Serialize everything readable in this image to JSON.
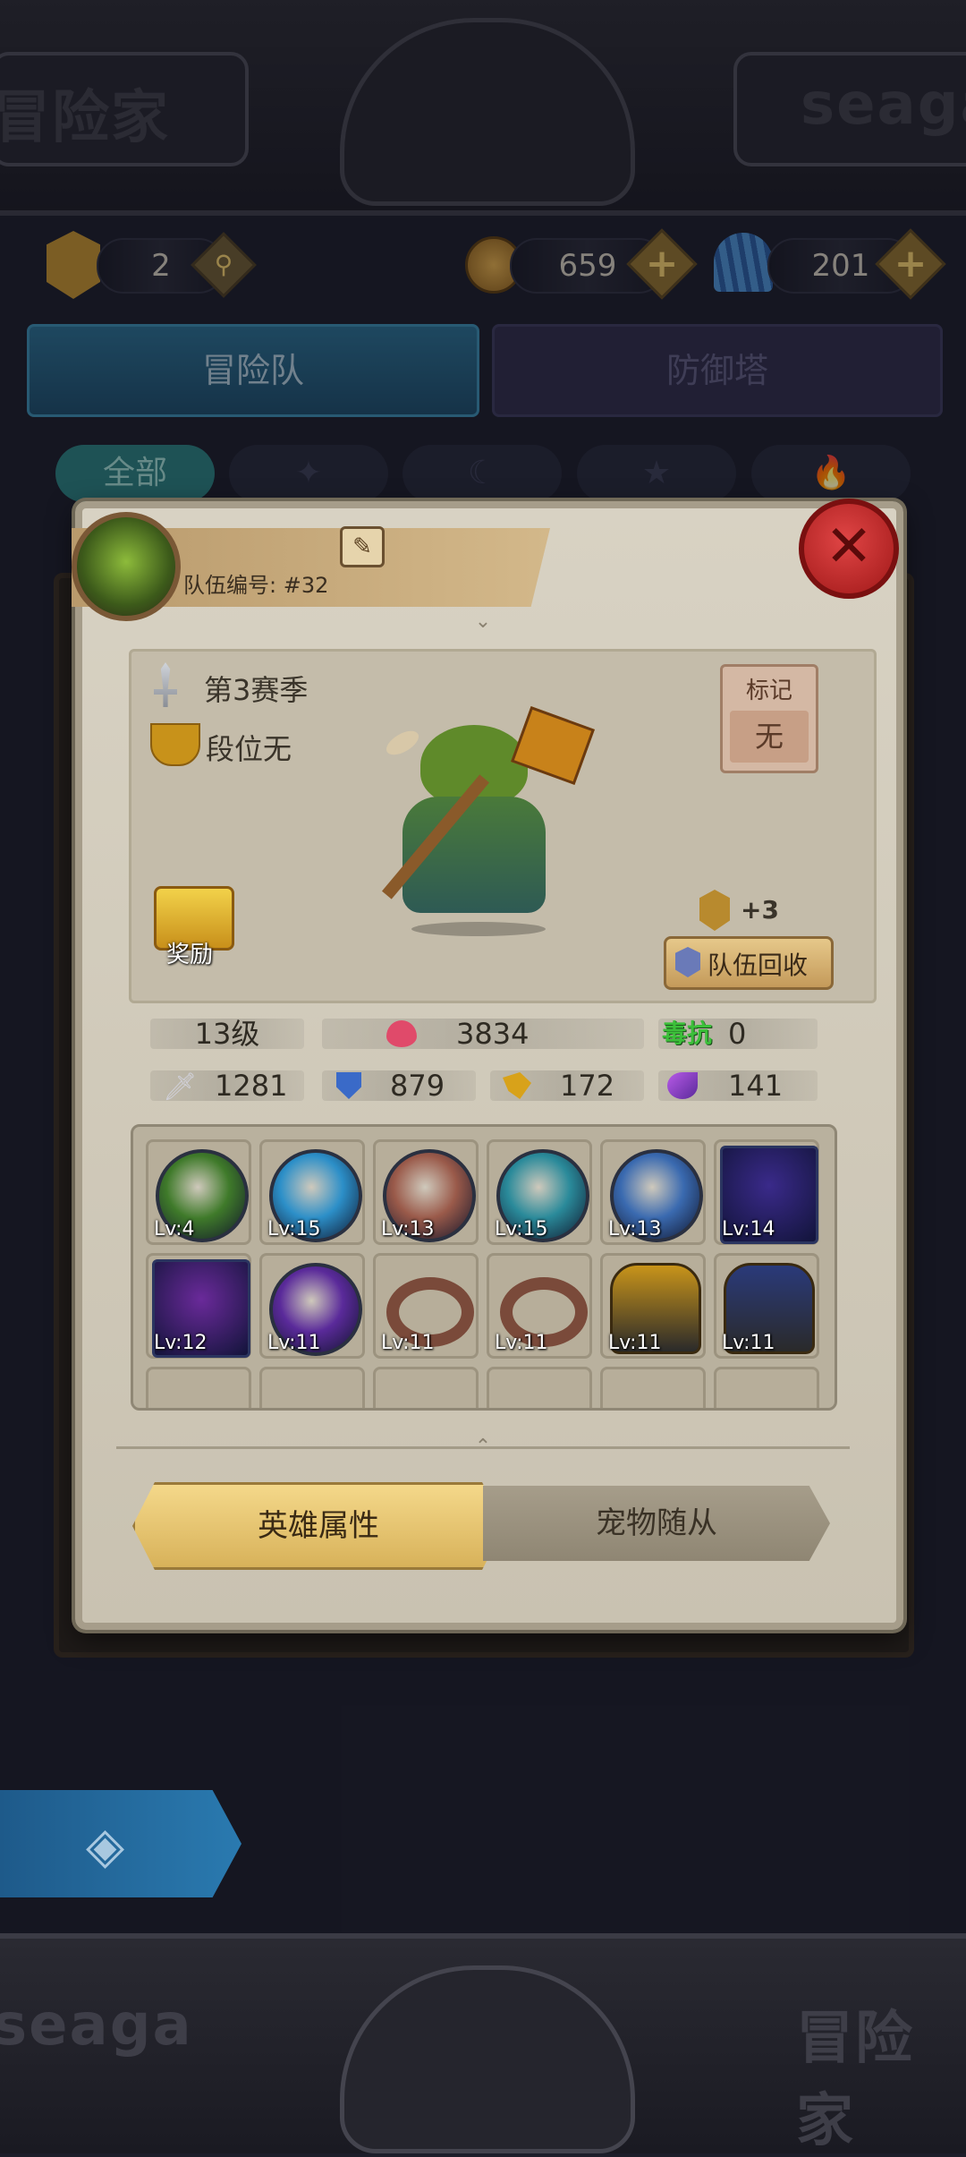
{
  "top": {
    "left_banner_text": "冒险家",
    "right_banner_text": "seaga"
  },
  "currency": {
    "rank_value": "2",
    "gold": "659",
    "shells": "201"
  },
  "main_tabs": [
    {
      "label": "冒险队"
    },
    {
      "label": "防御塔"
    }
  ],
  "filter_tabs": [
    {
      "label": "全部"
    },
    {
      "icon": "sparkle-icon"
    },
    {
      "icon": "moon-icon"
    },
    {
      "icon": "star-icon"
    },
    {
      "icon": "flame-icon"
    }
  ],
  "popup": {
    "team_number": "队伍编号: #32",
    "season": "第3赛季",
    "rank": "段位无",
    "mark_title": "标记",
    "mark_value": "无",
    "reward_label": "奖励",
    "recycle_bonus": "+3",
    "recycle_label": "队伍回收",
    "stats": {
      "level": "13级",
      "hp": "3834",
      "poison_label": "毒抗",
      "poison_value": "0",
      "attack": "1281",
      "defense": "879",
      "speed": "172",
      "magic": "141"
    },
    "equipment": [
      {
        "lv": "Lv:4",
        "color": "#3f7a2a",
        "shape": "orb"
      },
      {
        "lv": "Lv:15",
        "color": "#2c8fc8",
        "shape": "orb"
      },
      {
        "lv": "Lv:13",
        "color": "#9a5a4a",
        "shape": "orb"
      },
      {
        "lv": "Lv:15",
        "color": "#2a8a9a",
        "shape": "orb"
      },
      {
        "lv": "Lv:13",
        "color": "#3a6ab0",
        "shape": "orb"
      },
      {
        "lv": "Lv:14",
        "color": "#3a2a8a",
        "shape": "square"
      },
      {
        "lv": "Lv:12",
        "color": "#6a2a9a",
        "shape": "square"
      },
      {
        "lv": "Lv:11",
        "color": "#5a2a9a",
        "shape": "orb"
      },
      {
        "lv": "Lv:11",
        "color": "#7a4a3a",
        "shape": "ring"
      },
      {
        "lv": "Lv:11",
        "color": "#7a4a3a",
        "shape": "ring"
      },
      {
        "lv": "Lv:11",
        "color": "#c8941a",
        "shape": "item"
      },
      {
        "lv": "Lv:11",
        "color": "#2a3a7a",
        "shape": "item"
      }
    ],
    "tab_hero": "英雄属性",
    "tab_pet": "宠物随从"
  },
  "bottom": {
    "banner_text": "seaga",
    "right_banner_text": "冒险家"
  }
}
